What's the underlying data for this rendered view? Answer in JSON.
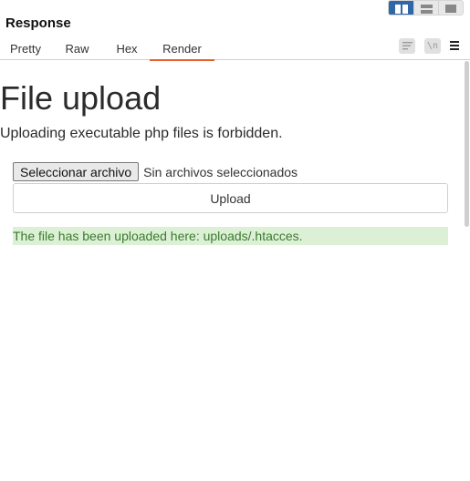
{
  "header": {
    "title": "Response",
    "layout_modes": [
      "side-by-side",
      "stacked-horizontal",
      "single"
    ],
    "active_layout": "side-by-side"
  },
  "tabs": [
    {
      "label": "Pretty",
      "active": false
    },
    {
      "label": "Raw",
      "active": false
    },
    {
      "label": "Hex",
      "active": false
    },
    {
      "label": "Render",
      "active": true
    }
  ],
  "tools": {
    "wrap_icon": "wrap-lines-icon",
    "newline_label": "\\n",
    "menu_icon": "hamburger-menu-icon"
  },
  "render": {
    "page_title": "File upload",
    "subtitle": "Uploading executable php files is forbidden.",
    "file_button_label": "Seleccionar archivo",
    "file_status": "Sin archivos seleccionados",
    "upload_label": "Upload",
    "result_message": "The file has been uploaded here: uploads/.htacces."
  },
  "colors": {
    "accent_tab": "#e8602c",
    "active_layout": "#2f67a8",
    "success_bg": "#dcf0d6",
    "success_text": "#3b7a2d"
  }
}
